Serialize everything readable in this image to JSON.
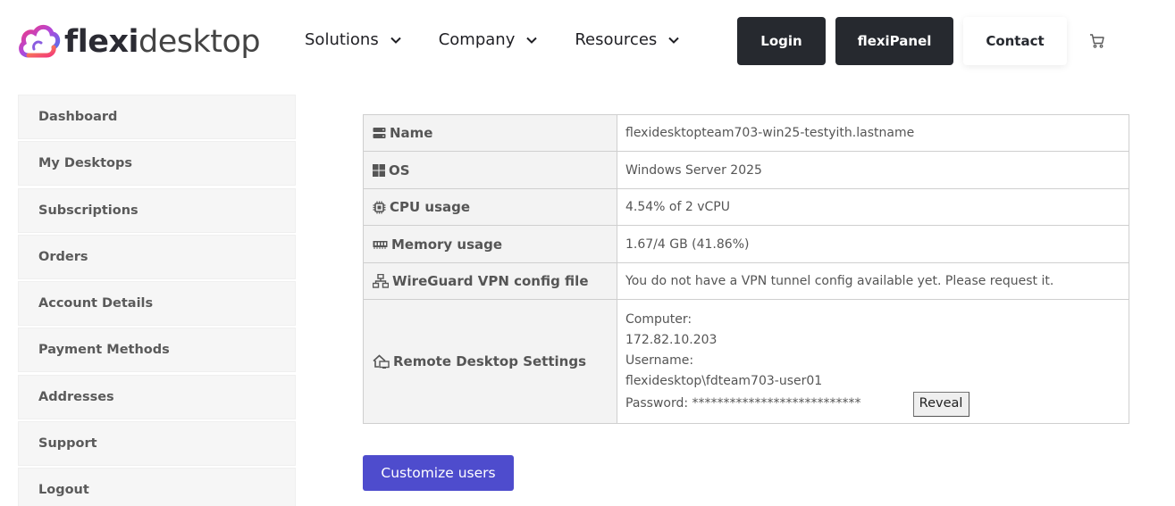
{
  "brand": {
    "logo_bold": "flexi",
    "logo_light": "desktop"
  },
  "nav": {
    "items": [
      {
        "label": "Solutions"
      },
      {
        "label": "Company"
      },
      {
        "label": "Resources"
      }
    ],
    "login_label": "Login",
    "flexipanel_label": "flexiPanel",
    "contact_label": "Contact",
    "cart_icon": "cart-icon"
  },
  "sidebar": {
    "items": [
      {
        "label": "Dashboard"
      },
      {
        "label": "My Desktops"
      },
      {
        "label": "Subscriptions"
      },
      {
        "label": "Orders"
      },
      {
        "label": "Account Details"
      },
      {
        "label": "Payment Methods"
      },
      {
        "label": "Addresses"
      },
      {
        "label": "Support"
      },
      {
        "label": "Logout"
      }
    ]
  },
  "details": {
    "name": {
      "label": "Name",
      "icon": "server-icon",
      "value": "flexidesktopteam703-win25-testyith.lastname"
    },
    "os": {
      "label": "OS",
      "icon": "windows-icon",
      "value": "Windows Server 2025"
    },
    "cpu": {
      "label": "CPU usage",
      "icon": "cpu-icon",
      "value": "4.54% of 2 vCPU"
    },
    "memory": {
      "label": "Memory usage",
      "icon": "memory-icon",
      "value": "1.67/4 GB (41.86%)"
    },
    "vpn": {
      "label": "WireGuard VPN config file",
      "icon": "network-icon",
      "value": "You do not have a VPN tunnel config available yet. Please request it."
    },
    "rdp": {
      "label": "Remote Desktop Settings",
      "icon": "remote-home-icon",
      "computer_label": "Computer:",
      "computer_value": "172.82.10.203",
      "username_label": "Username:",
      "username_value": "flexidesktop\\fdteam703-user01",
      "password_text": "Password: ***************************",
      "reveal_label": "Reveal"
    }
  },
  "actions": {
    "customize_label": "Customize users"
  },
  "colors": {
    "dark_button": "#26292f",
    "primary_button": "#4e4ccd",
    "sidebar_bg": "#f6f6f6",
    "label_bg": "#f3f3f3"
  }
}
